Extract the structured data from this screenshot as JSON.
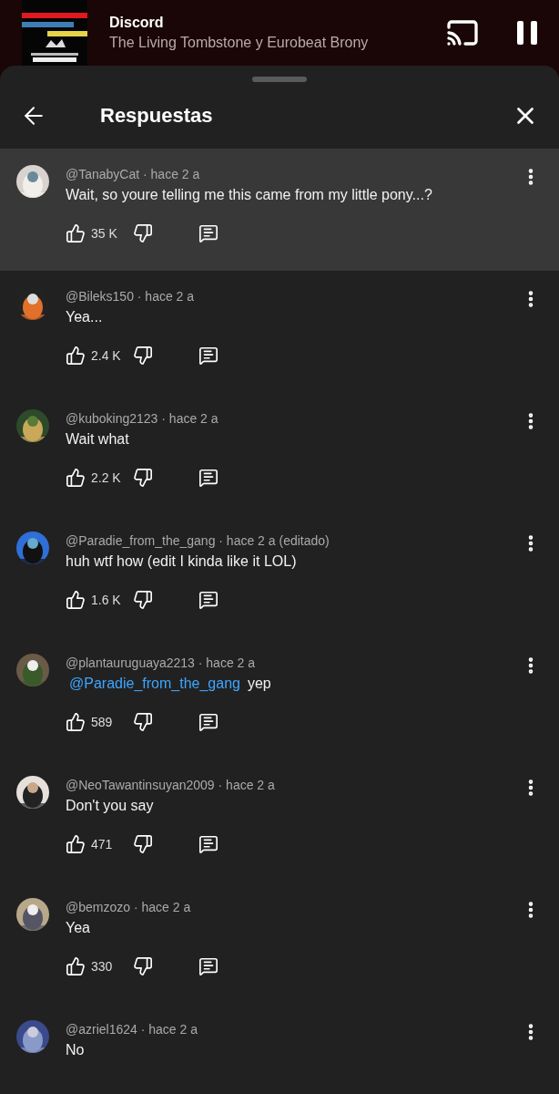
{
  "player": {
    "title": "Discord",
    "artist": "The Living Tombstone y Eurobeat Brony"
  },
  "sheet": {
    "title": "Respuestas"
  },
  "comments": [
    {
      "byline": "@TanabyCat · hace 2 a",
      "text": "Wait, so youre telling me this came from my little pony...?",
      "likes": "35 K",
      "highlighted": true
    },
    {
      "byline": "@Bileks150 · hace 2 a",
      "text": "Yea...",
      "likes": "2.4 K",
      "highlighted": false
    },
    {
      "byline": "@kuboking2123 · hace 2 a",
      "text": "Wait what",
      "likes": "2.2 K",
      "highlighted": false
    },
    {
      "byline": "@Paradie_from_the_gang · hace 2 a (editado)",
      "text": "huh wtf how (edit I kinda like it LOL)",
      "likes": "1.6 K",
      "highlighted": false
    },
    {
      "byline": "@plantauruguaya2213 · hace 2 a",
      "mention": "@Paradie_from_the_gang",
      "text": "yep",
      "likes": "589",
      "highlighted": false
    },
    {
      "byline": "@NeoTawantinsuyan2009 · hace 2 a",
      "text": "Don't you say",
      "likes": "471",
      "highlighted": false
    },
    {
      "byline": "@bemzozo · hace 2 a",
      "text": "Yea",
      "likes": "330",
      "highlighted": false
    },
    {
      "byline": "@azriel1624 · hace 2 a",
      "text": "No",
      "highlighted": false
    }
  ]
}
